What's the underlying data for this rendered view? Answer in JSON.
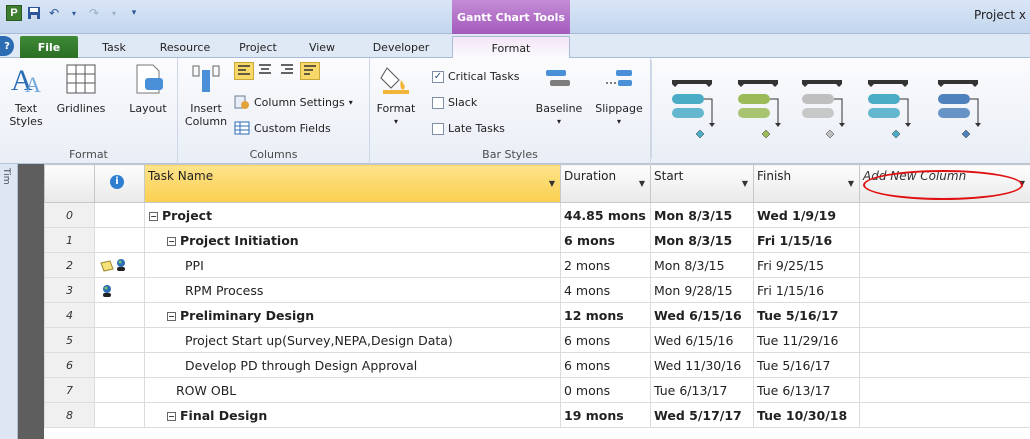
{
  "titlebar": {
    "app_icon_letter": "P",
    "context_tab": "Gantt Chart Tools",
    "window_title": "Project x"
  },
  "tabs": [
    {
      "label": "File"
    },
    {
      "label": "Task"
    },
    {
      "label": "Resource"
    },
    {
      "label": "Project"
    },
    {
      "label": "View"
    },
    {
      "label": "Developer"
    },
    {
      "label": "Format"
    }
  ],
  "ribbon": {
    "format_group": {
      "label": "Format",
      "text_styles": "Text Styles",
      "gridlines": "Gridlines",
      "layout": "Layout"
    },
    "columns_group": {
      "label": "Columns",
      "insert_column": "Insert Column",
      "column_settings": "Column Settings",
      "custom_fields": "Custom Fields"
    },
    "bar_styles_group": {
      "label": "Bar Styles",
      "format": "Format",
      "critical_tasks": "Critical Tasks",
      "slack": "Slack",
      "late_tasks": "Late Tasks",
      "baseline": "Baseline",
      "slippage": "Slippage"
    },
    "gantt_style_colors": [
      "#4bacc6",
      "#9bbb59",
      "#bfbfbf",
      "#4bacc6",
      "#4f81bd"
    ]
  },
  "grid": {
    "timeline_label": "Tim",
    "columns": {
      "info": "i",
      "task_name": "Task Name",
      "duration": "Duration",
      "start": "Start",
      "finish": "Finish",
      "add_new": "Add New Column"
    },
    "rows": [
      {
        "id": "0",
        "icons": "",
        "indent": 0,
        "toggle": "−",
        "name": "Project",
        "duration": "44.85 mons",
        "start": "Mon 8/3/15",
        "finish": "Wed 1/9/19",
        "summary": true
      },
      {
        "id": "1",
        "icons": "",
        "indent": 1,
        "toggle": "−",
        "name": "Project Initiation",
        "duration": "6 mons",
        "start": "Mon 8/3/15",
        "finish": "Fri 1/15/16",
        "summary": true
      },
      {
        "id": "2",
        "icons": "note+resource",
        "indent": 2,
        "toggle": "",
        "name": "PPI",
        "duration": "2 mons",
        "start": "Mon 8/3/15",
        "finish": "Fri 9/25/15",
        "summary": false
      },
      {
        "id": "3",
        "icons": "resource",
        "indent": 2,
        "toggle": "",
        "name": "RPM Process",
        "duration": "4 mons",
        "start": "Mon 9/28/15",
        "finish": "Fri 1/15/16",
        "summary": false
      },
      {
        "id": "4",
        "icons": "",
        "indent": 1,
        "toggle": "−",
        "name": "Preliminary Design",
        "duration": "12 mons",
        "start": "Wed 6/15/16",
        "finish": "Tue 5/16/17",
        "summary": true
      },
      {
        "id": "5",
        "icons": "",
        "indent": 2,
        "toggle": "",
        "name": "Project Start up(Survey,NEPA,Design Data)",
        "duration": "6 mons",
        "start": "Wed 6/15/16",
        "finish": "Tue 11/29/16",
        "summary": false
      },
      {
        "id": "6",
        "icons": "",
        "indent": 2,
        "toggle": "",
        "name": "Develop PD through Design Approval",
        "duration": "6 mons",
        "start": "Wed 11/30/16",
        "finish": "Tue 5/16/17",
        "summary": false
      },
      {
        "id": "7",
        "icons": "",
        "indent": 1.5,
        "toggle": "",
        "name": "ROW OBL",
        "duration": "0 mons",
        "start": "Tue 6/13/17",
        "finish": "Tue 6/13/17",
        "summary": false
      },
      {
        "id": "8",
        "icons": "",
        "indent": 1,
        "toggle": "−",
        "name": "Final Design",
        "duration": "19 mons",
        "start": "Wed 5/17/17",
        "finish": "Tue 10/30/18",
        "summary": true
      }
    ]
  }
}
